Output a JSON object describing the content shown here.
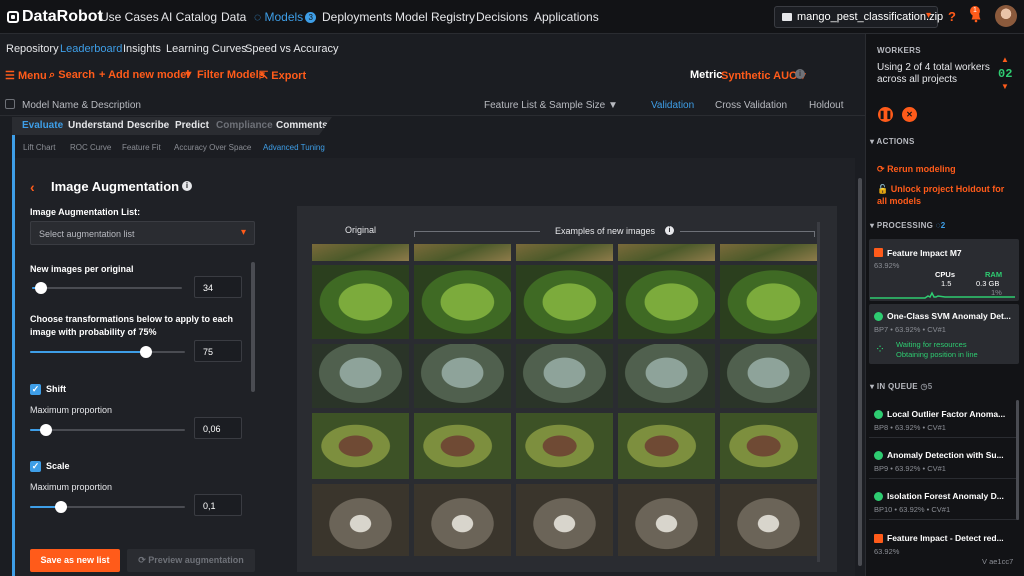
{
  "app": {
    "brand": "DataRobot",
    "nav": [
      "Use Cases",
      "AI Catalog",
      "Data",
      "Models",
      "Deployments",
      "Model Registry",
      "Decisions",
      "Applications"
    ],
    "models_badge": "3",
    "project": "mango_pest_classification.zip",
    "help": "?",
    "notif_badge": "1"
  },
  "subnav": [
    "Repository",
    "Leaderboard",
    "Insights",
    "Learning Curves",
    "Speed vs Accuracy"
  ],
  "toolbar": {
    "menu": "Menu",
    "search": "Search",
    "add_model": "Add new model",
    "filter": "Filter Models",
    "export": "Export",
    "metric_label": "Metric",
    "metric_value": "Synthetic AUC"
  },
  "columns": {
    "name": "Model Name & Description",
    "featurelist": "Feature List & Sample Size",
    "validation": "Validation",
    "cross_validation": "Cross Validation",
    "holdout": "Holdout"
  },
  "insight_tabs": [
    "Evaluate",
    "Understand",
    "Describe",
    "Predict",
    "Compliance",
    "Comments"
  ],
  "sub_tabs": [
    "Lift Chart",
    "ROC Curve",
    "Feature Fit",
    "Accuracy Over Space",
    "Advanced Tuning"
  ],
  "augmentation": {
    "title": "Image Augmentation",
    "list_label": "Image Augmentation List:",
    "list_placeholder": "Select augmentation list",
    "new_images_label": "New images per original",
    "new_images_value": "34",
    "new_images_fraction": 0.06,
    "prob_label_1": "Choose transformations below to apply to each",
    "prob_label_2": "image with probability of 75%",
    "prob_value": "75",
    "prob_fraction": 0.75,
    "shift_label": "Shift",
    "shift_max_label": "Maximum proportion",
    "shift_value": "0,06",
    "shift_fraction": 0.1,
    "scale_label": "Scale",
    "scale_max_label": "Maximum proportion",
    "scale_value": "0,1",
    "scale_fraction": 0.2,
    "save_button": "Save as new list",
    "preview_button": "Preview augmentation"
  },
  "grid": {
    "original_label": "Original",
    "examples_label": "Examples of new images"
  },
  "workers": {
    "heading": "WORKERS",
    "text": "Using 2 of 4 total workers across all projects",
    "count": "02",
    "actions_heading": "ACTIONS",
    "rerun": "Rerun modeling",
    "unlock": "Unlock project Holdout for all models",
    "processing_heading": "PROCESSING",
    "processing_count": "2",
    "job1_title": "Feature Impact M7",
    "job1_sub": "63.92%",
    "job1_cpus_label": "CPUs",
    "job1_cpus": "1.5",
    "job1_ram_label": "RAM",
    "job1_ram": "0.3 GB",
    "job1_pct": "1%",
    "job2_title": "One-Class SVM Anomaly Det...",
    "job2_sub": "BP7 • 63.92% • CV#1",
    "job2_wait": "Waiting for resources",
    "job2_obtain": "Obtaining position in line",
    "queue_heading": "IN QUEUE",
    "queue_count": "5",
    "queue": [
      {
        "title": "Local Outlier Factor Anoma...",
        "sub": "BP8 • 63.92% • CV#1"
      },
      {
        "title": "Anomaly Detection with Su...",
        "sub": "BP9 • 63.92% • CV#1"
      },
      {
        "title": "Isolation Forest Anomaly D...",
        "sub": "BP10 • 63.92% • CV#1"
      },
      {
        "title": "Feature Impact - Detect red...",
        "sub": "63.92%"
      }
    ],
    "version": "V ae1cc7"
  },
  "colors": {
    "accent": "#ff5b1a",
    "link": "#3e9ee7",
    "ok": "#2ecc71"
  }
}
